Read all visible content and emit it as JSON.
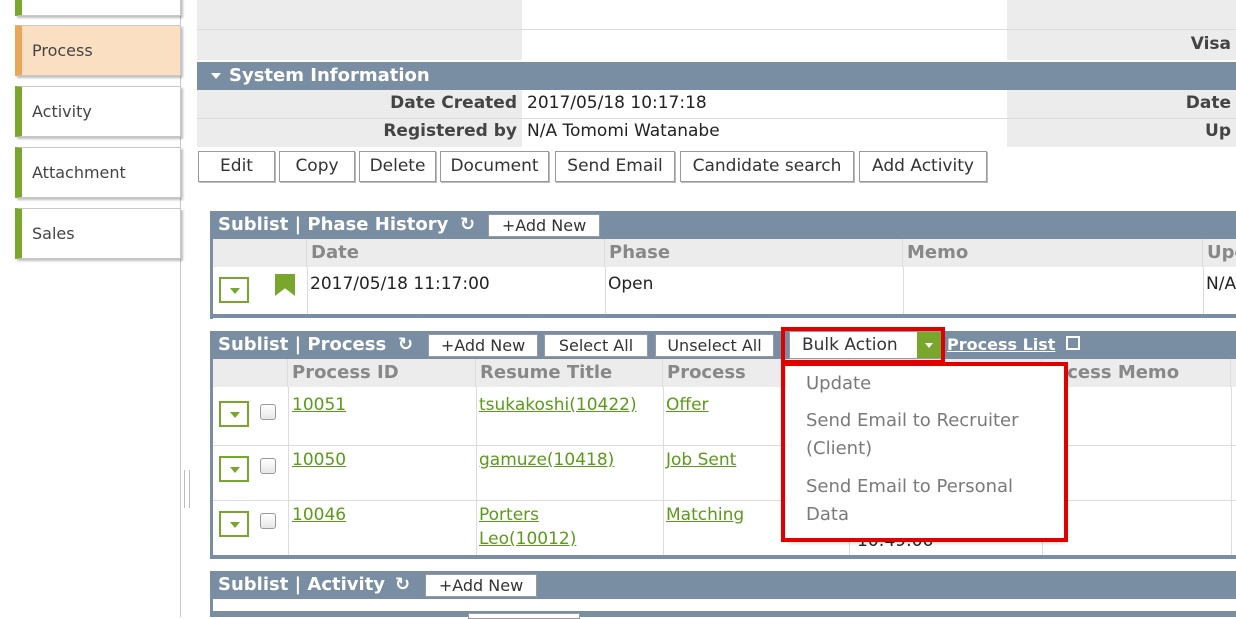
{
  "sidebar": {
    "tabs": [
      {
        "label": ""
      },
      {
        "label": "Process"
      },
      {
        "label": "Activity"
      },
      {
        "label": "Attachment"
      },
      {
        "label": "Sales"
      }
    ]
  },
  "header_top": {
    "right_label": "Visa"
  },
  "system_info": {
    "title": "System Information",
    "date_created_label": "Date Created",
    "date_created_value": "2017/05/18 10:17:18",
    "registered_by_label": "Registered by",
    "registered_by_value": "N/A Tomomi Watanabe",
    "right_label_1": "Date",
    "right_label_2": "Up"
  },
  "toolbar": {
    "edit": "Edit",
    "copy": "Copy",
    "delete": "Delete",
    "document": "Document",
    "send_email": "Send Email",
    "candidate_search": "Candidate search",
    "add_activity": "Add Activity"
  },
  "phase_history": {
    "title": "Sublist | Phase History",
    "add_new": "+Add New",
    "columns": [
      "Date",
      "Phase",
      "Memo",
      "Upo"
    ],
    "rows": [
      {
        "date": "2017/05/18 11:17:00",
        "phase": "Open",
        "memo": "",
        "updated": "N/A"
      }
    ]
  },
  "process": {
    "title": "Sublist | Process",
    "add_new": "+Add New",
    "select_all": "Select All",
    "unselect_all": "Unselect All",
    "bulk_action": "Bulk Action",
    "process_list": "Process List",
    "columns": [
      "Process ID",
      "Resume Title",
      "Process",
      "",
      "rocess Memo"
    ],
    "rows": [
      {
        "id": "10051",
        "resume": "tsukakoshi(10422)",
        "process": "Offer"
      },
      {
        "id": "10050",
        "resume": "gamuze(10418)",
        "process": "Job Sent"
      },
      {
        "id": "10046",
        "resume_line1": "Porters",
        "resume_line2": "Leo(10012)",
        "process": "Matching",
        "extra": "10:49:06"
      }
    ],
    "bulk_menu": {
      "item1": "Update",
      "item2_line1": "Send Email to Recruiter",
      "item2_line2": "(Client)",
      "item3_line1": "Send Email to Personal",
      "item3_line2": "Data"
    }
  },
  "activity": {
    "title": "Sublist | Activity",
    "add_new": "+Add New"
  },
  "colors": {
    "accent": "#79a62c",
    "header": "#7a8ea3",
    "highlight": "#e00000"
  }
}
